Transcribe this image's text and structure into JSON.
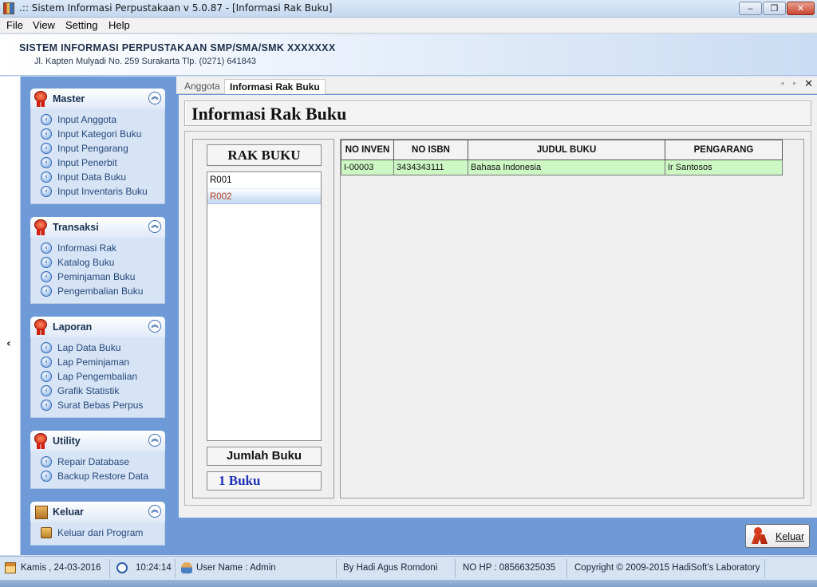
{
  "window": {
    "title": ".:: Sistem Informasi Perpustakaan v 5.0.87 - [Informasi Rak Buku]",
    "controls": [
      "minimize",
      "maximize",
      "close"
    ]
  },
  "menu": [
    "File",
    "View",
    "Setting",
    "Help"
  ],
  "header": {
    "school_name": "SISTEM INFORMASI PERPUSTAKAAN SMP/SMA/SMK  XXXXXXX",
    "address": "Jl. Kapten Mulyadi No. 259 Surakarta Tlp. (0271) 641843"
  },
  "sidebar": {
    "collapse_glyph": "‹",
    "groups": [
      {
        "title": "Master",
        "icon": "medal-icon",
        "items": [
          "Input Anggota",
          "Input Kategori Buku",
          "Input Pengarang",
          "Input Penerbit",
          "Input Data Buku",
          "Input Inventaris Buku"
        ]
      },
      {
        "title": "Transaksi",
        "icon": "medal-icon",
        "items": [
          "Informasi Rak",
          "Katalog Buku",
          "Peminjaman Buku",
          "Pengembalian Buku"
        ]
      },
      {
        "title": "Laporan",
        "icon": "medal-icon",
        "items": [
          "Lap Data Buku",
          "Lap Peminjaman",
          "Lap Pengembalian",
          "Grafik Statistik",
          "Surat Bebas Perpus"
        ]
      },
      {
        "title": "Utility",
        "icon": "medal-icon",
        "items": [
          "Repair Database",
          "Backup Restore Data"
        ]
      },
      {
        "title": "Keluar",
        "icon": "box-icon",
        "items": [
          "Keluar dari Program"
        ]
      }
    ]
  },
  "tabs": [
    {
      "label": "Anggota",
      "active": false
    },
    {
      "label": "Informasi Rak Buku",
      "active": true
    }
  ],
  "page": {
    "title": "Informasi Rak Buku",
    "rak_header": "RAK BUKU",
    "rak_list": [
      "R001",
      "R002"
    ],
    "rak_selected": "R002",
    "jumlah_label": "Jumlah Buku",
    "jumlah_value": "1 Buku"
  },
  "table": {
    "columns": [
      "NO INVEN",
      "NO ISBN",
      "JUDUL BUKU",
      "PENGARANG"
    ],
    "rows": [
      [
        "I-00003",
        "3434343111",
        "Bahasa Indonesia",
        "Ir Santosos"
      ]
    ],
    "row_highlight_color": "#cdf8c4"
  },
  "exit_button": {
    "label": "Keluar",
    "icon": "exit-person-icon"
  },
  "status": {
    "date": "Kamis ,  24-03-2016",
    "time": "10:24:14",
    "user": "User Name : Admin",
    "author": "By Hadi Agus Romdoni",
    "phone": "NO HP : 08566325035",
    "copyright": "Copyright © 2009-2015 HadiSoft's Laboratory"
  },
  "colors": {
    "sidebar_bg": "#6e9bd8",
    "accent_blue": "#1f33b5",
    "selection_text": "#b5401f"
  }
}
